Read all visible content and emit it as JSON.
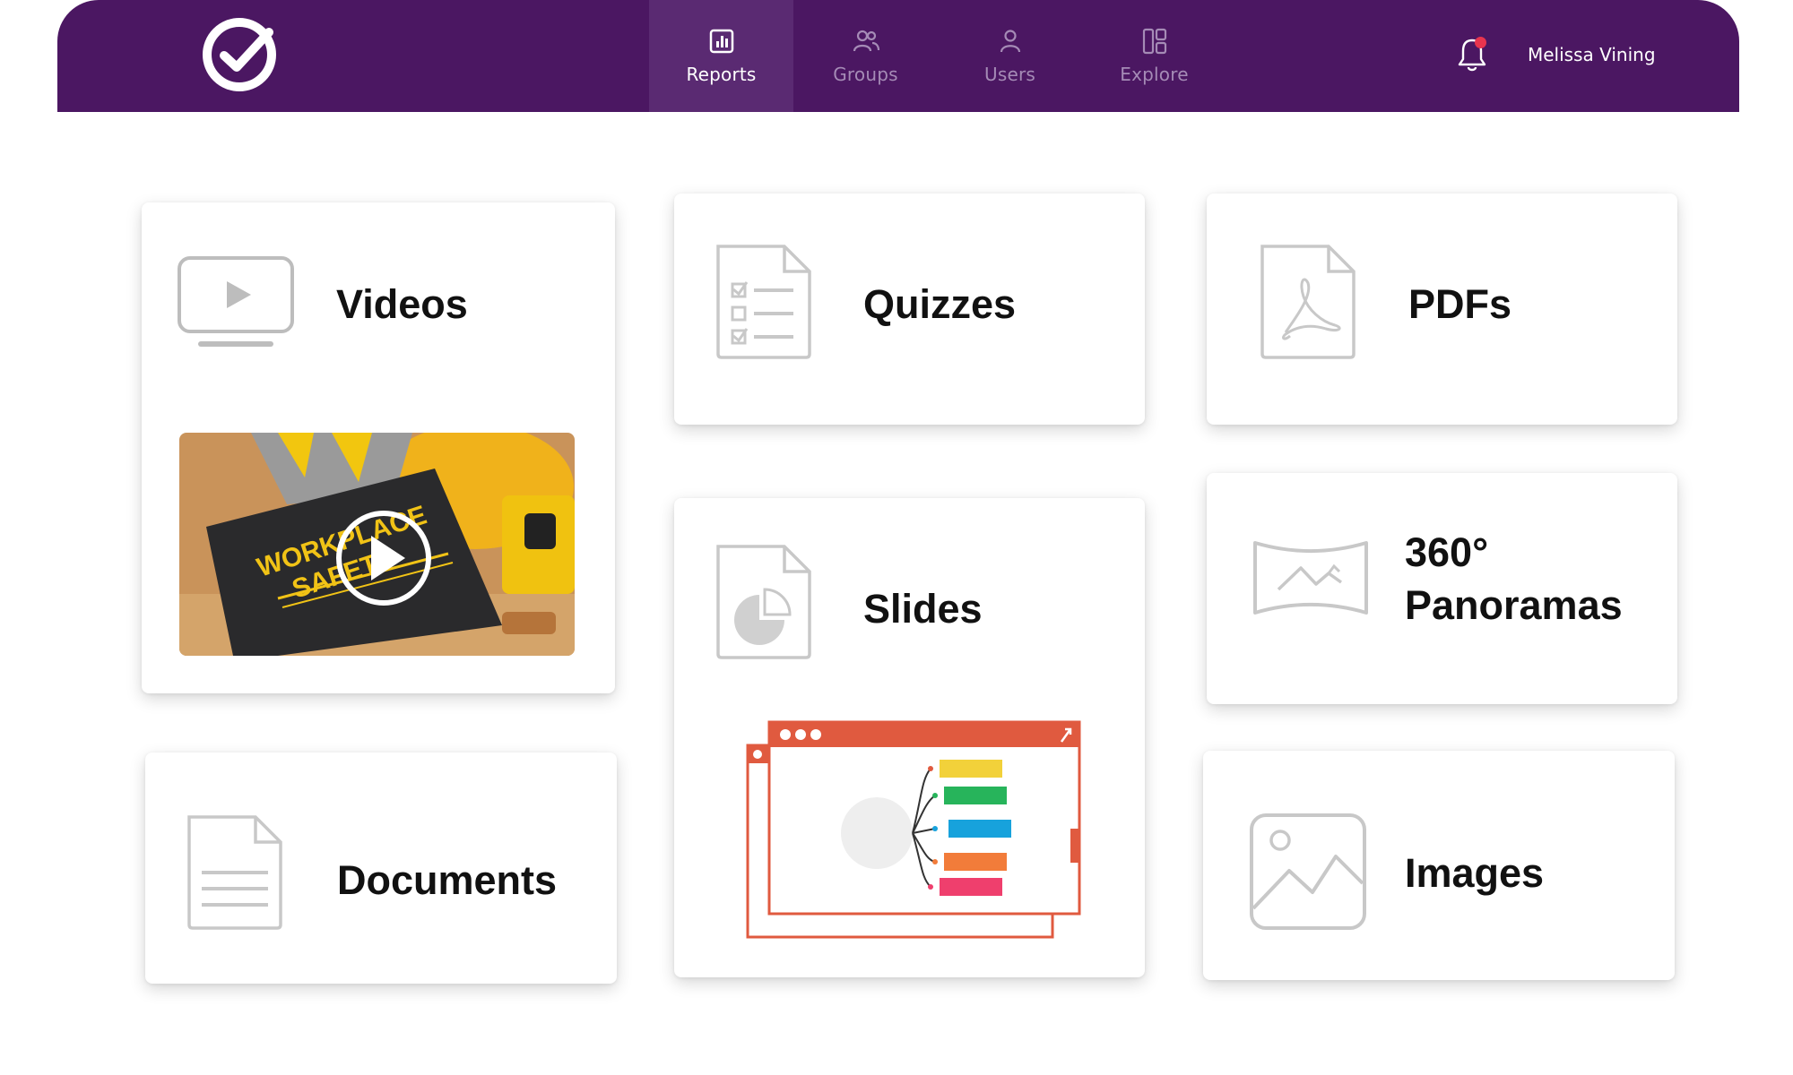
{
  "app": {
    "user_name": "Melissa Vining"
  },
  "nav": {
    "items": [
      {
        "label": "Reports",
        "icon": "bar-chart-icon",
        "active": true
      },
      {
        "label": "Groups",
        "icon": "users-group-icon",
        "active": false
      },
      {
        "label": "Users",
        "icon": "user-icon",
        "active": false
      },
      {
        "label": "Explore",
        "icon": "dashboard-grid-icon",
        "active": false
      }
    ]
  },
  "cards": {
    "videos": {
      "title": "Videos",
      "icon": "monitor-play-icon",
      "thumbnail_text": "WORKPLACE SAFETY"
    },
    "quizzes": {
      "title": "Quizzes",
      "icon": "checklist-document-icon"
    },
    "pdfs": {
      "title": "PDFs",
      "icon": "pdf-document-icon"
    },
    "slides": {
      "title": "Slides",
      "icon": "pie-chart-document-icon"
    },
    "panoramas": {
      "title_line1": "360°",
      "title_line2": "Panoramas",
      "icon": "panorama-icon"
    },
    "documents": {
      "title": "Documents",
      "icon": "text-document-icon"
    },
    "images": {
      "title": "Images",
      "icon": "image-icon"
    }
  },
  "colors": {
    "topbar": "#4b1762",
    "topbar_active": "#5a2a72",
    "nav_inactive": "#a58bb6",
    "notification_dot": "#e8344e",
    "slides_accent": "#e05a3f",
    "icon_gray": "#bdbdbd"
  }
}
